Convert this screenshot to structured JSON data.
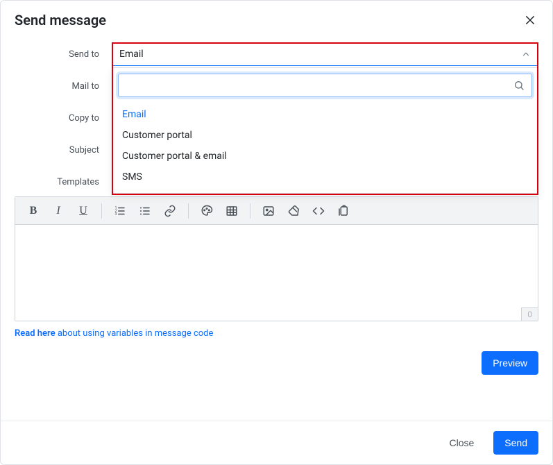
{
  "header": {
    "title": "Send message"
  },
  "form": {
    "labels": {
      "send_to": "Send to",
      "mail_to": "Mail to",
      "copy_to": "Copy to",
      "subject": "Subject",
      "templates": "Templates"
    },
    "send_to_select": {
      "value": "Email",
      "options": [
        "Email",
        "Customer portal",
        "Customer portal & email",
        "SMS"
      ],
      "search_value": ""
    }
  },
  "editor": {
    "char_count": "0"
  },
  "hint": {
    "link_text": "Read here",
    "rest_text": " about using variables in message code"
  },
  "buttons": {
    "preview": "Preview",
    "close": "Close",
    "send": "Send"
  }
}
